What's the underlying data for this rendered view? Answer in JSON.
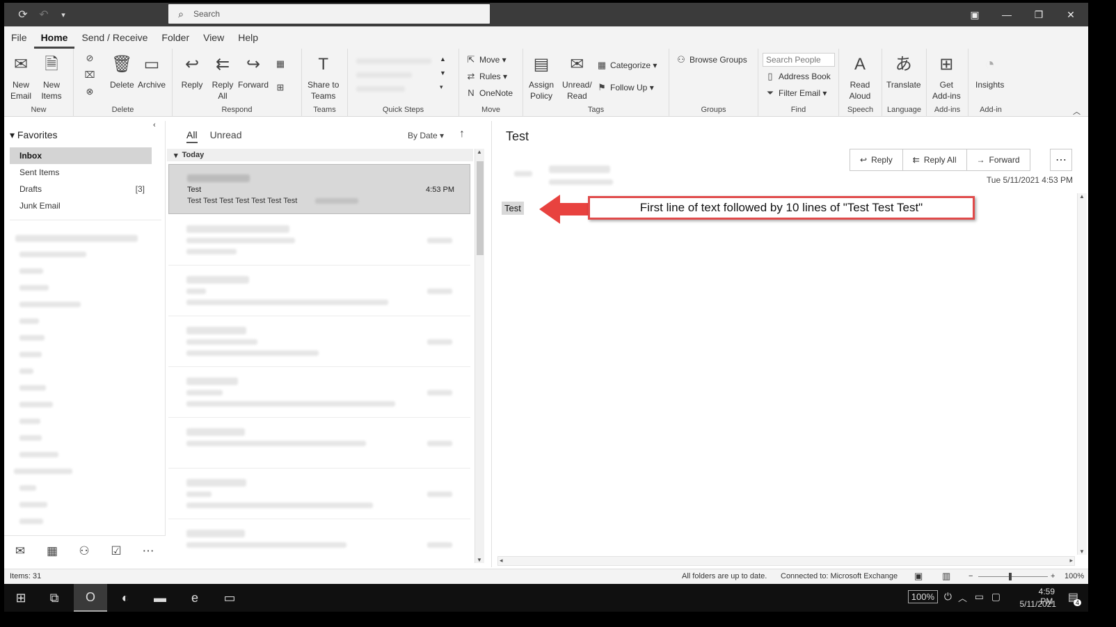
{
  "titlebar": {
    "search_placeholder": "Search"
  },
  "menu": [
    "File",
    "Home",
    "Send / Receive",
    "Folder",
    "View",
    "Help"
  ],
  "ribbon": {
    "new_group": {
      "label": "New",
      "new_email": "New\nEmail",
      "new_items": "New\nItems"
    },
    "delete_group": {
      "label": "Delete",
      "delete": "Delete",
      "archive": "Archive"
    },
    "respond_group": {
      "label": "Respond",
      "reply": "Reply",
      "reply_all": "Reply\nAll",
      "forward": "Forward"
    },
    "teams_group": {
      "label": "Teams",
      "share": "Share to\nTeams"
    },
    "quicksteps_group": {
      "label": "Quick Steps"
    },
    "move_group": {
      "label": "Move",
      "move": "Move",
      "rules": "Rules",
      "onenote": "OneNote"
    },
    "tags_group": {
      "label": "Tags",
      "assign_policy": "Assign\nPolicy",
      "unread_read": "Unread/\nRead",
      "categorize": "Categorize",
      "follow_up": "Follow Up"
    },
    "groups_group": {
      "label": "Groups",
      "browse": "Browse Groups"
    },
    "find_group": {
      "label": "Find",
      "search_people": "Search People",
      "address_book": "Address Book",
      "filter_email": "Filter Email"
    },
    "speech_group": {
      "label": "Speech",
      "read_aloud": "Read\nAloud"
    },
    "language_group": {
      "label": "Language",
      "translate": "Translate"
    },
    "addins_group": {
      "label": "Add-ins",
      "get_addins": "Get\nAdd-ins"
    },
    "addin_group": {
      "label": "Add-in",
      "insights": "Insights"
    }
  },
  "nav": {
    "favorites": "Favorites",
    "items": [
      {
        "label": "Inbox",
        "count": ""
      },
      {
        "label": "Sent Items",
        "count": ""
      },
      {
        "label": "Drafts",
        "count": "[3]"
      },
      {
        "label": "Junk Email",
        "count": ""
      }
    ]
  },
  "list": {
    "tab_all": "All",
    "tab_unread": "Unread",
    "sort": "By Date",
    "group_today": "Today",
    "selected": {
      "subject": "Test",
      "preview": "Test  Test  Test  Test  Test  Test  Test",
      "time": "4:53 PM"
    }
  },
  "reading": {
    "subject": "Test",
    "actions": {
      "reply": "Reply",
      "reply_all": "Reply All",
      "forward": "Forward"
    },
    "date": "Tue 5/11/2021 4:53 PM",
    "body_first_line": "Test",
    "callout": "First line of text followed by 10 lines of \"Test Test Test\""
  },
  "status": {
    "items": "Items: 31",
    "folders": "All folders are up to date.",
    "connected": "Connected to: Microsoft Exchange",
    "zoom": "100%"
  },
  "taskbar": {
    "zoom_badge": "100%",
    "time": "4:59 PM",
    "date": "5/11/2021",
    "notif_count": "4"
  },
  "colors": {
    "callout_border": "#e04a4a",
    "arrow": "#e8423f"
  }
}
